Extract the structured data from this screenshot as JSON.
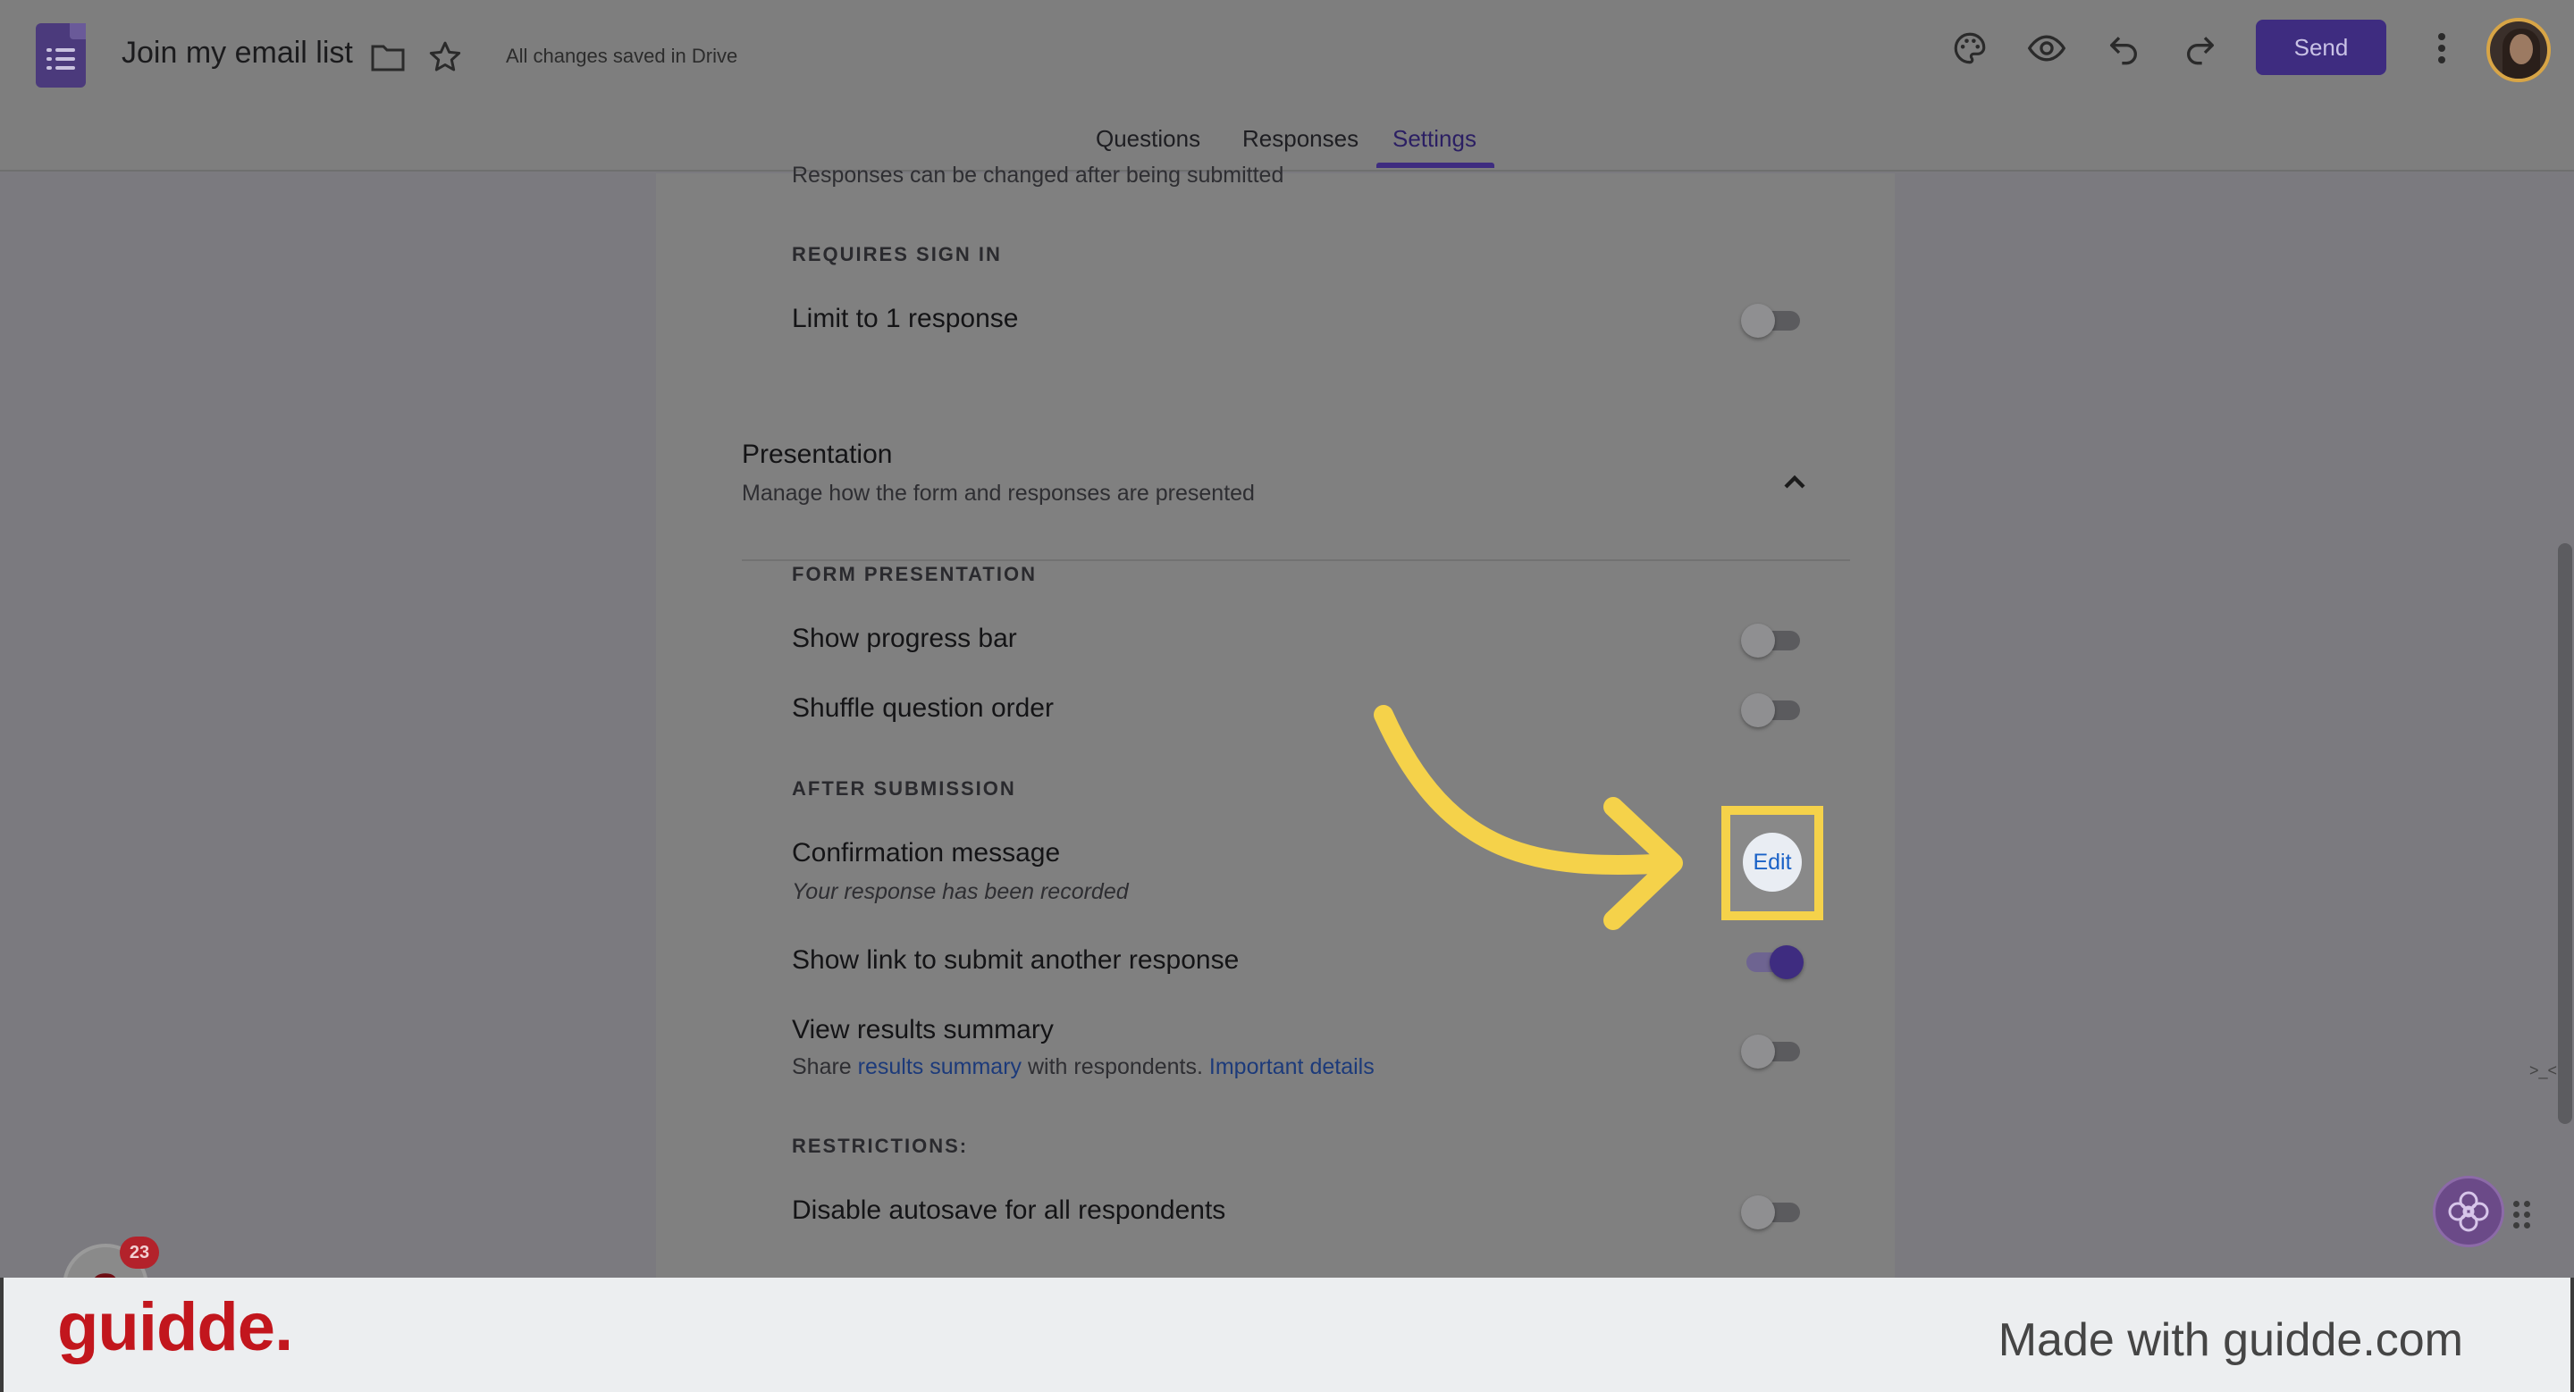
{
  "header": {
    "doc_title": "Join my email list",
    "save_status": "All changes saved in Drive",
    "send_label": "Send"
  },
  "tabs": [
    {
      "label": "Questions",
      "active": false
    },
    {
      "label": "Responses",
      "active": false
    },
    {
      "label": "Settings",
      "active": true
    }
  ],
  "settings": {
    "top_partial_text": "Responses can be changed after being submitted",
    "requires_sign_in_caption": "REQUIRES SIGN IN",
    "limit_one": {
      "label": "Limit to 1 response",
      "on": false
    },
    "presentation": {
      "title": "Presentation",
      "subtitle": "Manage how the form and responses are presented"
    },
    "form_presentation_caption": "FORM PRESENTATION",
    "show_progress_bar": {
      "label": "Show progress bar",
      "on": false
    },
    "shuffle_question_order": {
      "label": "Shuffle question order",
      "on": false
    },
    "after_submission_caption": "AFTER SUBMISSION",
    "confirmation_message": {
      "label": "Confirmation message",
      "value": "Your response has been recorded",
      "edit_label": "Edit"
    },
    "show_link": {
      "label": "Show link to submit another response",
      "on": true
    },
    "view_results": {
      "label": "View results summary",
      "desc_prefix": "Share ",
      "desc_link": "results summary",
      "desc_middle": " with respondents. ",
      "desc_link2": "Important details",
      "on": false
    },
    "restrictions_caption": "RESTRICTIONS:",
    "disable_autosave": {
      "label": "Disable autosave for all respondents",
      "on": false
    }
  },
  "widgets": {
    "notification_count": "23",
    "notification_letter": "a",
    "side_hint": ">_<"
  },
  "footer": {
    "brand": "guidde.",
    "made_with": "Made with guidde.com"
  },
  "colors": {
    "accent_purple": "#3e2c80",
    "highlight_yellow": "#f5d24a",
    "link_blue": "#1a62c7",
    "brand_red": "#c2161d"
  }
}
